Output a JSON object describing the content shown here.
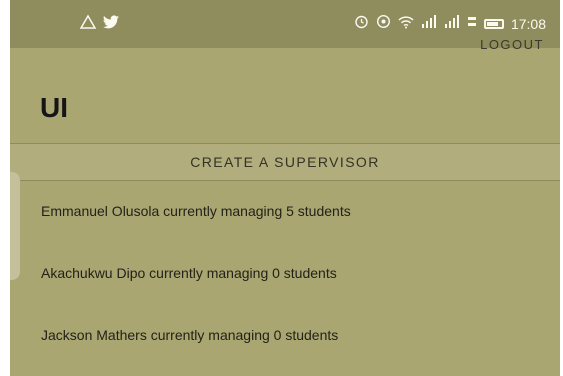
{
  "status_bar": {
    "left_icons": [
      "warning-triangle-icon",
      "twitter-bird-icon"
    ],
    "right_icons": [
      "alarm-icon",
      "location-icon",
      "wifi-icon",
      "signal-icon",
      "signal-icon",
      "network-speed-icon",
      "battery-icon"
    ],
    "time": "17:08"
  },
  "toolbar": {
    "logout_label": "LOGOUT"
  },
  "page": {
    "title": "UI"
  },
  "actions": {
    "create_supervisor_label": "CREATE A SUPERVISOR"
  },
  "supervisors": [
    "Emmanuel Olusola currently managing 5 students",
    "Akachukwu Dipo currently managing 0 students",
    "Jackson Mathers currently managing 0 students"
  ],
  "colors": {
    "app_background": "#aaa672",
    "status_bar": "#8f8c5e",
    "text": "#151515"
  }
}
